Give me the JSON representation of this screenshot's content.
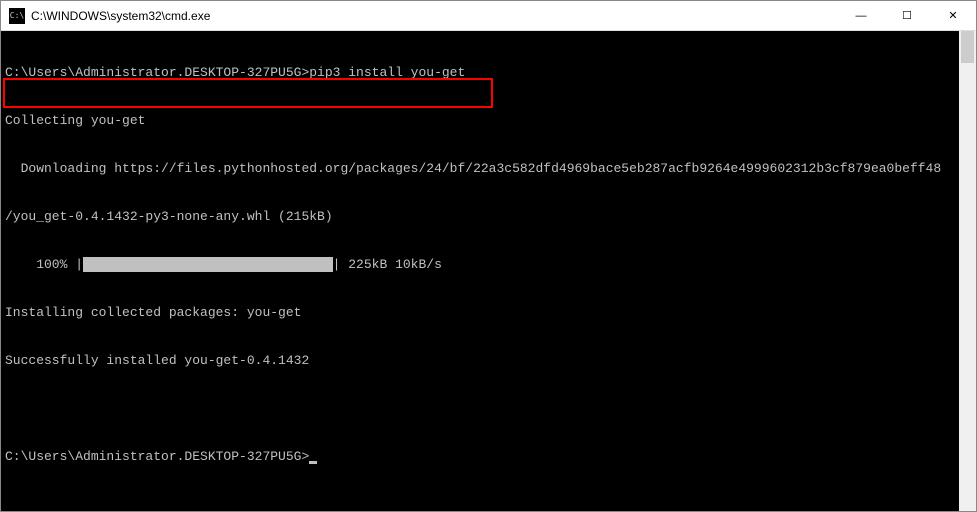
{
  "titlebar": {
    "icon_label": "C:\\",
    "title": "C:\\WINDOWS\\system32\\cmd.exe",
    "minimize": "—",
    "maximize": "☐",
    "close": "✕"
  },
  "terminal": {
    "line1_prompt": "C:\\Users\\Administrator.DESKTOP-327PU5G>",
    "line1_command": "pip3 install you-get",
    "line2": "Collecting you-get",
    "line3": "  Downloading https://files.pythonhosted.org/packages/24/bf/22a3c582dfd4969bace5eb287acfb9264e4999602312b3cf879ea0beff48",
    "line4": "/you_get-0.4.1432-py3-none-any.whl (215kB)",
    "line5_percent": "    100% |",
    "line5_bar": "████████████████████████████████",
    "line5_stats": "| 225kB 10kB/s",
    "line6": "Installing collected packages: you-get",
    "line7": "Successfully installed you-get-0.4.1432",
    "line8_blank": "",
    "line9_prompt": "C:\\Users\\Administrator.DESKTOP-327PU5G>"
  }
}
